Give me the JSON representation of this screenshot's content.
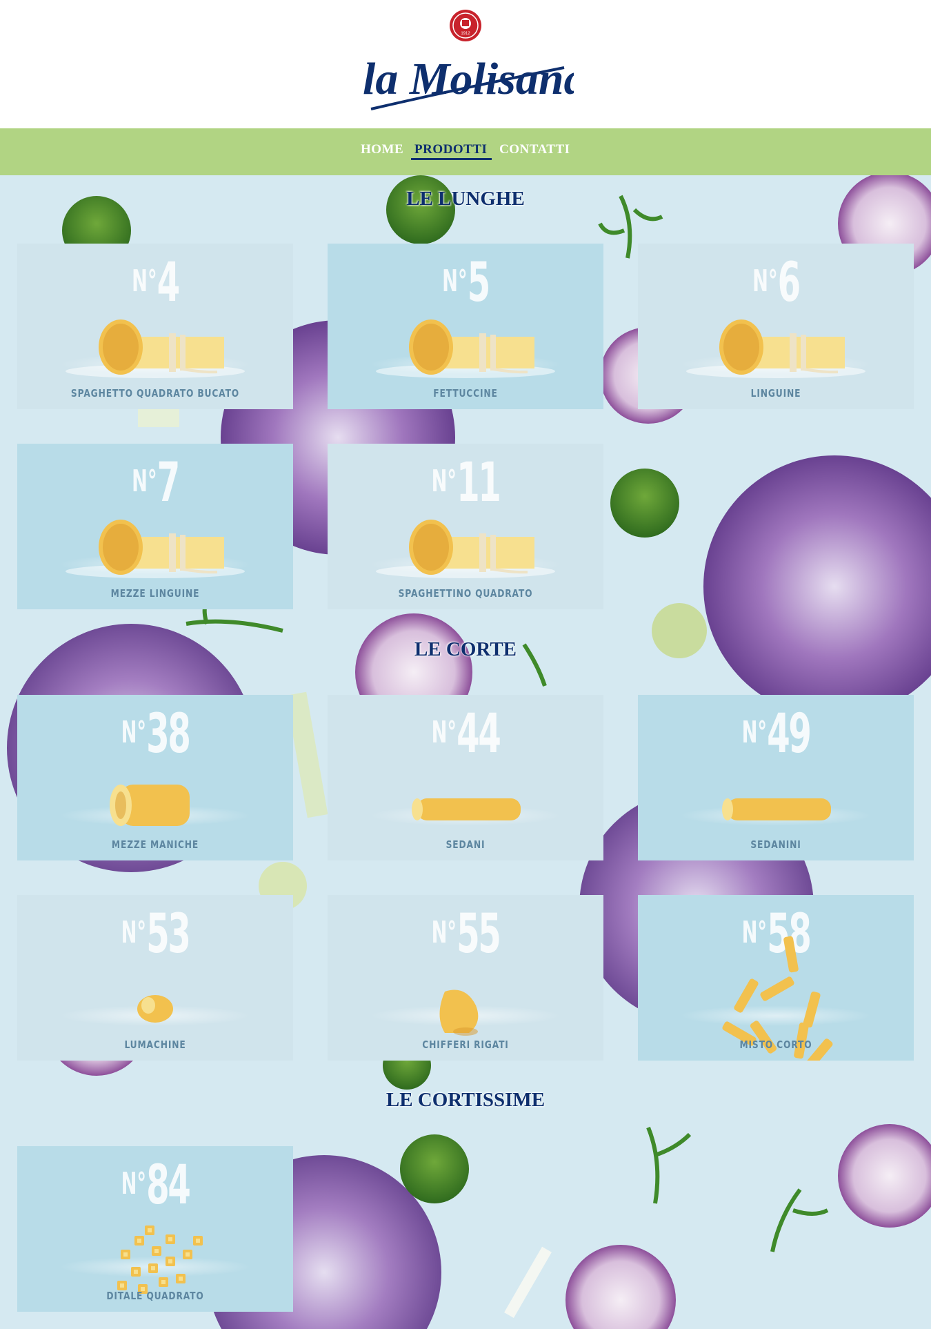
{
  "brand": {
    "logo_text": "la Molisana",
    "seal_text": "1912"
  },
  "nav": {
    "items": [
      "HOME",
      "PRODOTTI",
      "CONTATTI"
    ],
    "active": "PRODOTTI"
  },
  "colors": {
    "nav_bg": "#b1d483",
    "brand_blue": "#0e2f6e",
    "card_light": "#d0e4ec",
    "card_blue": "#b8dce8"
  },
  "sections": [
    {
      "title": "LE LUNGHE",
      "products": [
        {
          "number": "4",
          "name": "SPAGHETTO QUADRATO BUCATO",
          "shape": "long"
        },
        {
          "number": "5",
          "name": "FETTUCCINE",
          "shape": "long"
        },
        {
          "number": "6",
          "name": "LINGUINE",
          "shape": "long"
        },
        {
          "number": "7",
          "name": "MEZZE LINGUINE",
          "shape": "long"
        },
        {
          "number": "11",
          "name": "SPAGHETTINO QUADRATO",
          "shape": "long"
        }
      ]
    },
    {
      "title": "LE CORTE",
      "products": [
        {
          "number": "38",
          "name": "MEZZE MANICHE",
          "shape": "tube"
        },
        {
          "number": "44",
          "name": "SEDANI",
          "shape": "thin-tube"
        },
        {
          "number": "49",
          "name": "SEDANINI",
          "shape": "thin-tube"
        },
        {
          "number": "53",
          "name": "LUMACHINE",
          "shape": "shell"
        },
        {
          "number": "55",
          "name": "CHIFFERI RIGATI",
          "shape": "elbow"
        },
        {
          "number": "58",
          "name": "MISTO CORTO",
          "shape": "mix"
        }
      ]
    },
    {
      "title": "LE CORTISSIME",
      "products": [
        {
          "number": "84",
          "name": "DITALE QUADRATO",
          "shape": "cubes"
        }
      ]
    }
  ]
}
